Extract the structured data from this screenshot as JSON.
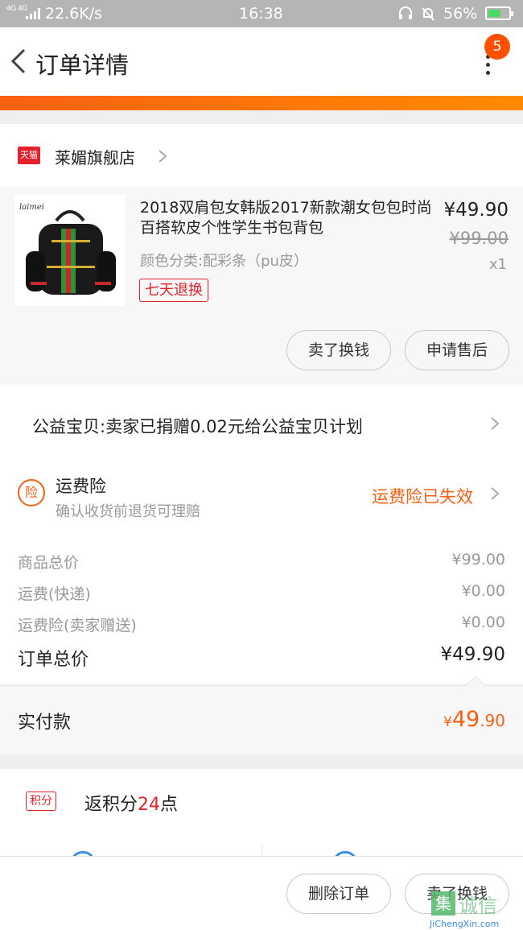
{
  "status_bar": {
    "signal": "4G 4G",
    "speed": "22.6K/s",
    "time": "16:38",
    "battery": "56%"
  },
  "header": {
    "title": "订单详情",
    "badge_count": "5"
  },
  "shop": {
    "tag": "天猫",
    "name": "莱媚旗舰店"
  },
  "product": {
    "image_brand": "laimei",
    "title": "2018双肩包女韩版2017新款潮女包包时尚百搭软皮个性学生书包背包",
    "attribute": "颜色分类:配彩条（pu皮）",
    "tag": "七天退换",
    "price": "¥49.90",
    "original_price": "¥99.00",
    "quantity": "x1",
    "buttons": {
      "sell": "卖了换钱",
      "after_sale": "申请售后"
    }
  },
  "charity": {
    "text": "公益宝贝:卖家已捐赠0.02元给公益宝贝计划"
  },
  "insurance": {
    "icon_text": "险",
    "title": "运费险",
    "subtitle": "确认收货前退货可理赔",
    "status": "运费险已失效"
  },
  "totals": {
    "goods_label": "商品总价",
    "goods_value": "¥99.00",
    "shipping_label": "运费(快递)",
    "shipping_value": "¥0.00",
    "insurance_label": "运费险(卖家赠送)",
    "insurance_value": "¥0.00",
    "order_label": "订单总价",
    "order_value": "¥49.90"
  },
  "paid": {
    "label": "实付款",
    "currency": "¥",
    "integer": "49",
    "decimal": ".90"
  },
  "points": {
    "tag": "积分",
    "prefix": "返积分",
    "count": "24",
    "suffix": "点"
  },
  "bottom": {
    "delete": "删除订单",
    "sell": "卖了换钱"
  },
  "watermark": {
    "logo": "集",
    "text": "诚信",
    "url": "JiChengXin.com"
  },
  "colors": {
    "accent": "#f86013",
    "tmall_red": "#e4212c",
    "badge": "#ff5000"
  }
}
